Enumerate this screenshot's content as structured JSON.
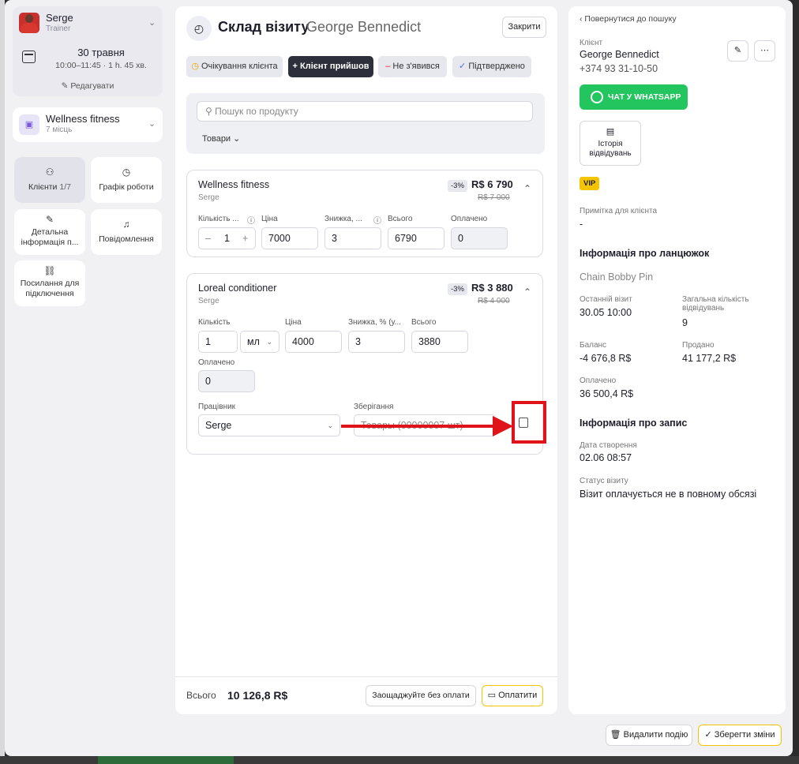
{
  "sidebar": {
    "user": {
      "name": "Serge",
      "role": "Trainer"
    },
    "date": "30 травня",
    "time": "10:00–11:45 · 1 h. 45 хв.",
    "edit_label": "Редагувати",
    "room": {
      "name": "Wellness fitness",
      "sub": "7 місць"
    },
    "tiles": [
      {
        "label": "Клієнти",
        "count": "1/7"
      },
      {
        "label": "Графік роботи"
      },
      {
        "label": "Детальна інформація п..."
      },
      {
        "label": "Повідомлення"
      },
      {
        "label": "Посилання для підключення"
      }
    ]
  },
  "visit": {
    "title": "Склад візиту",
    "client": "George Bennedict",
    "close_label": "Закрити",
    "statuses": [
      "Очікування клієнта",
      "Клієнт прийшов",
      "Не з'явився",
      "Підтверджено"
    ],
    "search_placeholder": "Пошук по продукту",
    "filter_label": "Товари",
    "items": [
      {
        "name": "Wellness fitness",
        "staff": "Serge",
        "discount_badge": "-3%",
        "price": "R$ 6 790",
        "old_price": "R$ 7 000",
        "labels": {
          "qty": "Кількість ...",
          "price": "Ціна",
          "discount": "Знижка, ...",
          "total": "Всього",
          "paid": "Оплачено"
        },
        "qty": "1",
        "price_val": "7000",
        "discount_val": "3",
        "total_val": "6790",
        "paid_val": "0"
      },
      {
        "name": "Loreal conditioner",
        "staff": "Serge",
        "discount_badge": "-3%",
        "price": "R$ 3 880",
        "old_price": "R$ 4 000",
        "labels": {
          "qty": "Кількість",
          "price": "Ціна",
          "discount": "Знижка, % (у...",
          "total": "Всього",
          "paid": "Оплачено",
          "worker": "Працівник",
          "storage": "Зберігання"
        },
        "qty": "1",
        "unit": "мл",
        "price_val": "4000",
        "discount_val": "3",
        "total_val": "3880",
        "paid_val": "0",
        "worker_val": "Serge",
        "storage_val": "Товары (00000007 шт)"
      }
    ],
    "total_label": "Всього",
    "total_value": "10 126,8 R$",
    "save_no_pay_label": "Заощаджуйте без оплати",
    "pay_label": "Оплатити"
  },
  "client_panel": {
    "back_label": "Повернутися до пошуку",
    "client_label": "Клієнт",
    "name": "George Bennedict",
    "phone": "+374 93 31-10-50",
    "whatsapp_label": "ЧАТ У WHATSAPP",
    "history_label": "Історія відвідувань",
    "vip": "VIP",
    "note_label": "Примітка для клієнта",
    "note_value": "-",
    "chain_heading": "Інформація про ланцюжок",
    "chain_name": "Chain Bobby Pin",
    "last_visit_label": "Останній візит",
    "last_visit_value": "30.05 10:00",
    "total_visits_label": "Загальна кількість відвідувань",
    "total_visits_value": "9",
    "balance_label": "Баланс",
    "balance_value": "-4 676,8 R$",
    "sold_label": "Продано",
    "sold_value": "41 177,2 R$",
    "paid_label": "Оплачено",
    "paid_value": "36 500,4 R$",
    "record_heading": "Інформація про запис",
    "created_label": "Дата створення",
    "created_value": "02.06 08:57",
    "status_label": "Статус візиту",
    "status_value": "Візит оплачується не в повному обсязі"
  },
  "footer": {
    "delete_label": "Видалити подію",
    "save_label": "Зберегти зміни"
  },
  "colors": {
    "accent_dark": "#2d2f3a",
    "whatsapp": "#22c55e",
    "vip": "#f5c400",
    "annotation": "#e0131a",
    "pay_border": "#f5c400"
  }
}
